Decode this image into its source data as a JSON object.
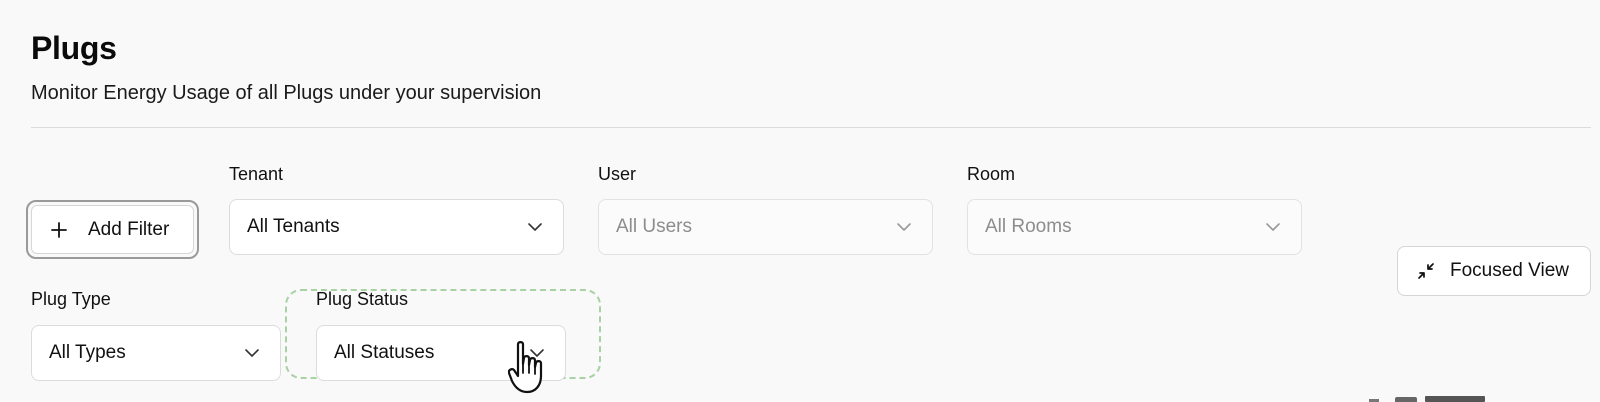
{
  "header": {
    "title": "Plugs",
    "subtitle": "Monitor Energy Usage of all Plugs under your supervision"
  },
  "filters": {
    "add_filter_label": "Add Filter",
    "tenant": {
      "label": "Tenant",
      "value": "All Tenants"
    },
    "user": {
      "label": "User",
      "value": "All Users"
    },
    "room": {
      "label": "Room",
      "value": "All Rooms"
    },
    "plug_type": {
      "label": "Plug Type",
      "value": "All Types"
    },
    "plug_status": {
      "label": "Plug Status",
      "value": "All Statuses"
    }
  },
  "actions": {
    "focused_view_label": "Focused View"
  },
  "icons": {
    "add": "plus-icon",
    "dropdown": "chevron-down-icon",
    "focused_view": "minimize-arrows-icon",
    "cursor": "hand-pointer-cursor-icon"
  },
  "colors": {
    "highlight": "#a8d2a4",
    "background": "#f9f9f9"
  }
}
